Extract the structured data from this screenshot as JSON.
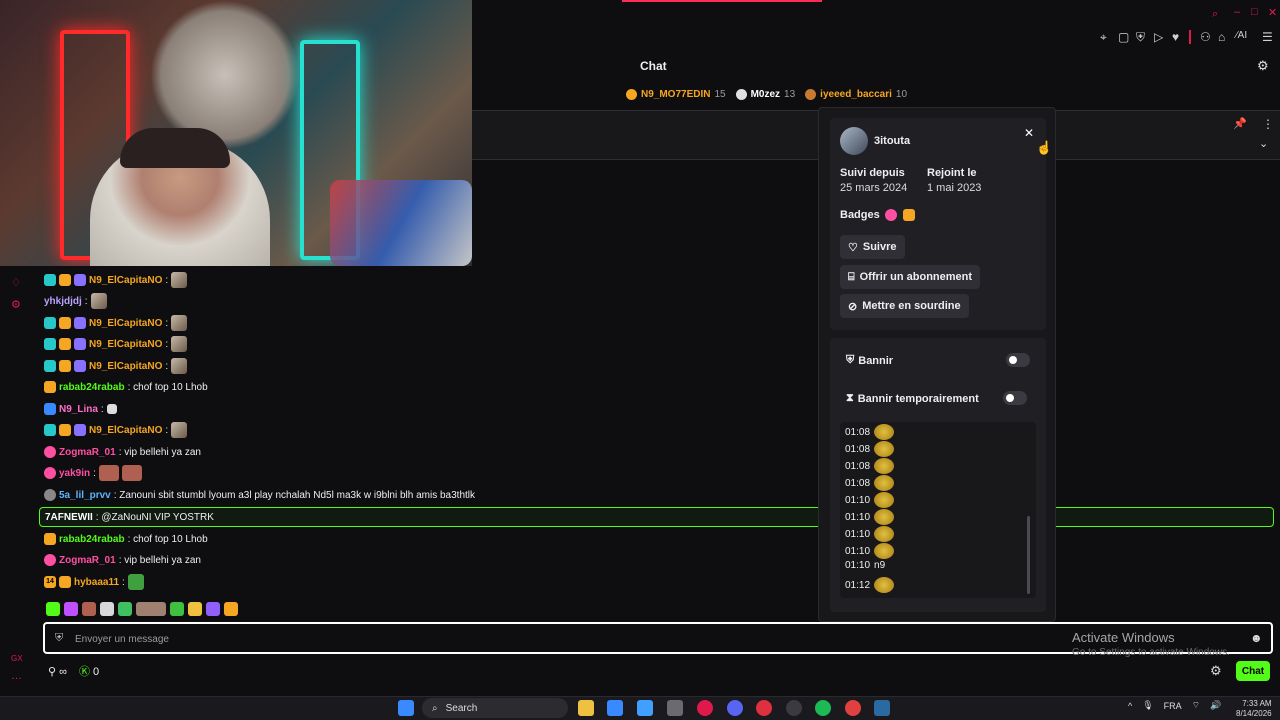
{
  "webcam": {
    "label": "webcam-feed"
  },
  "chat_header": {
    "title": "Chat"
  },
  "leaderboard": [
    {
      "name": "N9_MO77EDIN",
      "count": "15",
      "color": "#f5a623"
    },
    {
      "name": "M0zez",
      "count": "13",
      "color": "#ffffff"
    },
    {
      "name": "iyeeed_baccari",
      "count": "10",
      "color": "#f5a623"
    }
  ],
  "messages": [
    {
      "user": "N9_ElCapitaNO",
      "text": ":",
      "color": "#f5a623"
    },
    {
      "user": "yhkjdjdj",
      "text": ":",
      "color": "#b9a3ff"
    },
    {
      "user": "N9_ElCapitaNO",
      "text": ":",
      "color": "#f5a623"
    },
    {
      "user": "N9_ElCapitaNO",
      "text": ":",
      "color": "#f5a623"
    },
    {
      "user": "N9_ElCapitaNO",
      "text": ":",
      "color": "#f5a623"
    },
    {
      "user": "rabab24rabab",
      "text": ": chof top 10 Lhob",
      "color": "#53fc18"
    },
    {
      "user": "N9_Lina",
      "text": ":",
      "color": "#ff6ec7"
    },
    {
      "user": "N9_ElCapitaNO",
      "text": ":",
      "color": "#f5a623"
    },
    {
      "user": "ZogmaR_01",
      "text": ": vip bellehi ya zan",
      "color": "#ff4fa3"
    },
    {
      "user": "yak9in",
      "text": ":",
      "color": "#ff4fa3"
    },
    {
      "user": "5a_lil_prvv",
      "text": ": Zanouni sbit stumbl lyoum a3l play nchalah Nd5l ma3k w i9blni blh amis ba3thtlk",
      "color": "#5ab4ff"
    },
    {
      "user": "7AFNEWII",
      "text": ": @ZaNouNI VIP YOSTRK",
      "color": "#ffffff"
    },
    {
      "user": "rabab24rabab",
      "text": ": chof top 10 Lhob",
      "color": "#53fc18"
    },
    {
      "user": "ZogmaR_01",
      "text": ": vip bellehi ya zan",
      "color": "#ff4fa3"
    },
    {
      "user": "hybaaa11",
      "text": ":",
      "color": "#f5a623"
    }
  ],
  "sub_badge_14": "14",
  "input": {
    "placeholder": "Envoyer un message"
  },
  "footer": {
    "infinity": "∞",
    "count": "0",
    "chat_button": "Chat"
  },
  "windows_watermark": {
    "line1": "Activate Windows",
    "line2": "Go to Settings to activate Windows."
  },
  "user_card": {
    "username": "3itouta",
    "followed_label": "Suivi depuis",
    "followed_value": "25 mars 2024",
    "joined_label": "Rejoint le",
    "joined_value": "1 mai 2023",
    "badges_label": "Badges",
    "follow_button": "Suivre",
    "gift_button": "Offrir un abonnement",
    "mute_button": "Mettre en sourdine",
    "ban_label": "Bannir",
    "timeout_label": "Bannir temporairement",
    "log": [
      {
        "time": "01:08",
        "text": ""
      },
      {
        "time": "01:08",
        "text": ""
      },
      {
        "time": "01:08",
        "text": ""
      },
      {
        "time": "01:08",
        "text": ""
      },
      {
        "time": "01:10",
        "text": ""
      },
      {
        "time": "01:10",
        "text": ""
      },
      {
        "time": "01:10",
        "text": ""
      },
      {
        "time": "01:10",
        "text": ""
      },
      {
        "time": "01:10",
        "text": "n9"
      },
      {
        "time": "01:12",
        "text": ""
      }
    ]
  },
  "taskbar": {
    "search": "Search",
    "lang": "FRA",
    "time": "7:33 AM",
    "date": "8/14/2026"
  },
  "colors": {
    "accent": "#53fc18",
    "bg": "#0e0e10",
    "panel": "#18181b"
  }
}
